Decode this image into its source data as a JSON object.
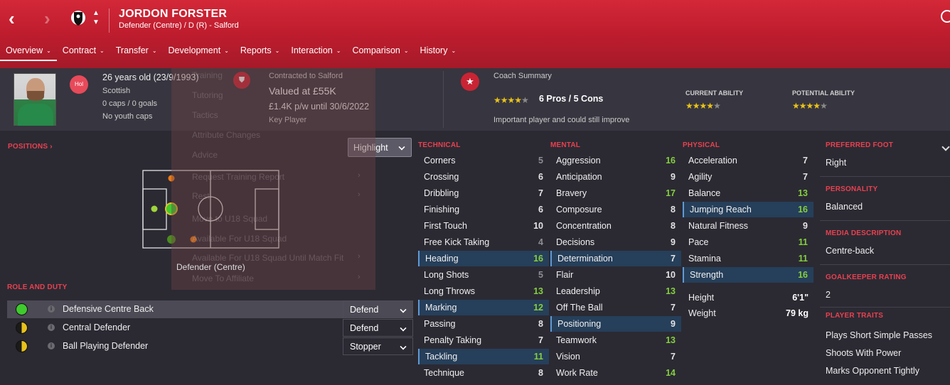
{
  "header": {
    "name": "JORDON FORSTER",
    "subtitle": "Defender (Centre) / D (R) - Salford",
    "back": "‹",
    "forward": "›",
    "arrow_up": "▲",
    "arrow_down": "▼"
  },
  "tabs": [
    {
      "label": "Overview"
    },
    {
      "label": "Contract"
    },
    {
      "label": "Transfer"
    },
    {
      "label": "Development"
    },
    {
      "label": "Reports"
    },
    {
      "label": "Interaction"
    },
    {
      "label": "Comparison"
    },
    {
      "label": "History"
    }
  ],
  "tab_chevron": "⌄",
  "info": {
    "hol_badge": "Hol",
    "age": "26 years old (23/9/1993)",
    "nationality": "Scottish",
    "caps": "0 caps / 0 goals",
    "youth": "No youth caps"
  },
  "contract": {
    "title": "Contracted to Salford",
    "value": "Valued at £55K",
    "wage": "£1.4K p/w until 30/6/2022",
    "status": "Key Player"
  },
  "coach": {
    "title": "Coach Summary",
    "pros_cons": "6 Pros / 5 Cons",
    "note": "Important player and could still improve",
    "current_ability_label": "CURRENT ABILITY",
    "potential_ability_label": "POTENTIAL ABILITY",
    "summary_stars": 4,
    "current_stars": 4,
    "potential_stars": 4
  },
  "ghost_menu": [
    "Training",
    "Tutoring",
    "Tactics",
    "Attribute Changes",
    "Advice",
    "Request Training Report",
    "Rest",
    "Move to U18 Squad",
    "Available For U18 Squad",
    "Available For U18 Squad Until Match Fit",
    "Move To Affiliate"
  ],
  "positions": {
    "label": "POSITIONS ›",
    "highlight": "Highlight",
    "position_name": "Defender (Centre)"
  },
  "roles": {
    "label": "ROLE AND DUTY",
    "items": [
      {
        "name": "Defensive Centre Back",
        "duty": "Defend"
      },
      {
        "name": "Central Defender",
        "duty": "Defend"
      },
      {
        "name": "Ball Playing Defender",
        "duty": "Stopper"
      }
    ]
  },
  "technical": {
    "label": "TECHNICAL",
    "items": [
      {
        "name": "Corners",
        "value": "5"
      },
      {
        "name": "Crossing",
        "value": "6"
      },
      {
        "name": "Dribbling",
        "value": "7"
      },
      {
        "name": "Finishing",
        "value": "6"
      },
      {
        "name": "First Touch",
        "value": "10"
      },
      {
        "name": "Free Kick Taking",
        "value": "4"
      },
      {
        "name": "Heading",
        "value": "16"
      },
      {
        "name": "Long Shots",
        "value": "5"
      },
      {
        "name": "Long Throws",
        "value": "13"
      },
      {
        "name": "Marking",
        "value": "12"
      },
      {
        "name": "Passing",
        "value": "8"
      },
      {
        "name": "Penalty Taking",
        "value": "7"
      },
      {
        "name": "Tackling",
        "value": "11"
      },
      {
        "name": "Technique",
        "value": "8"
      }
    ]
  },
  "mental": {
    "label": "MENTAL",
    "items": [
      {
        "name": "Aggression",
        "value": "16"
      },
      {
        "name": "Anticipation",
        "value": "9"
      },
      {
        "name": "Bravery",
        "value": "17"
      },
      {
        "name": "Composure",
        "value": "8"
      },
      {
        "name": "Concentration",
        "value": "8"
      },
      {
        "name": "Decisions",
        "value": "9"
      },
      {
        "name": "Determination",
        "value": "7"
      },
      {
        "name": "Flair",
        "value": "10"
      },
      {
        "name": "Leadership",
        "value": "13"
      },
      {
        "name": "Off The Ball",
        "value": "7"
      },
      {
        "name": "Positioning",
        "value": "9"
      },
      {
        "name": "Teamwork",
        "value": "13"
      },
      {
        "name": "Vision",
        "value": "7"
      },
      {
        "name": "Work Rate",
        "value": "14"
      }
    ]
  },
  "physical": {
    "label": "PHYSICAL",
    "items": [
      {
        "name": "Acceleration",
        "value": "7"
      },
      {
        "name": "Agility",
        "value": "7"
      },
      {
        "name": "Balance",
        "value": "13"
      },
      {
        "name": "Jumping Reach",
        "value": "16"
      },
      {
        "name": "Natural Fitness",
        "value": "9"
      },
      {
        "name": "Pace",
        "value": "11"
      },
      {
        "name": "Stamina",
        "value": "11"
      },
      {
        "name": "Strength",
        "value": "16"
      }
    ]
  },
  "body": {
    "height_label": "Height",
    "height": "6'1\"",
    "weight_label": "Weight",
    "weight": "79 kg"
  },
  "right_panel": {
    "foot_label": "PREFERRED FOOT",
    "foot": "Right",
    "personality_label": "PERSONALITY",
    "personality": "Balanced",
    "media_label": "MEDIA DESCRIPTION",
    "media": "Centre-back",
    "gk_label": "GOALKEEPER RATING",
    "gk": "2",
    "traits_label": "PLAYER TRAITS",
    "traits": [
      "Plays Short Simple Passes",
      "Shoots With Power",
      "Marks Opponent Tightly"
    ]
  },
  "colors": {
    "header_red": "#c92434",
    "accent_red": "#e8414f",
    "attr_good": "#85cf3e",
    "highlight_blue": "#263f5a",
    "background": "#2b2a33"
  }
}
